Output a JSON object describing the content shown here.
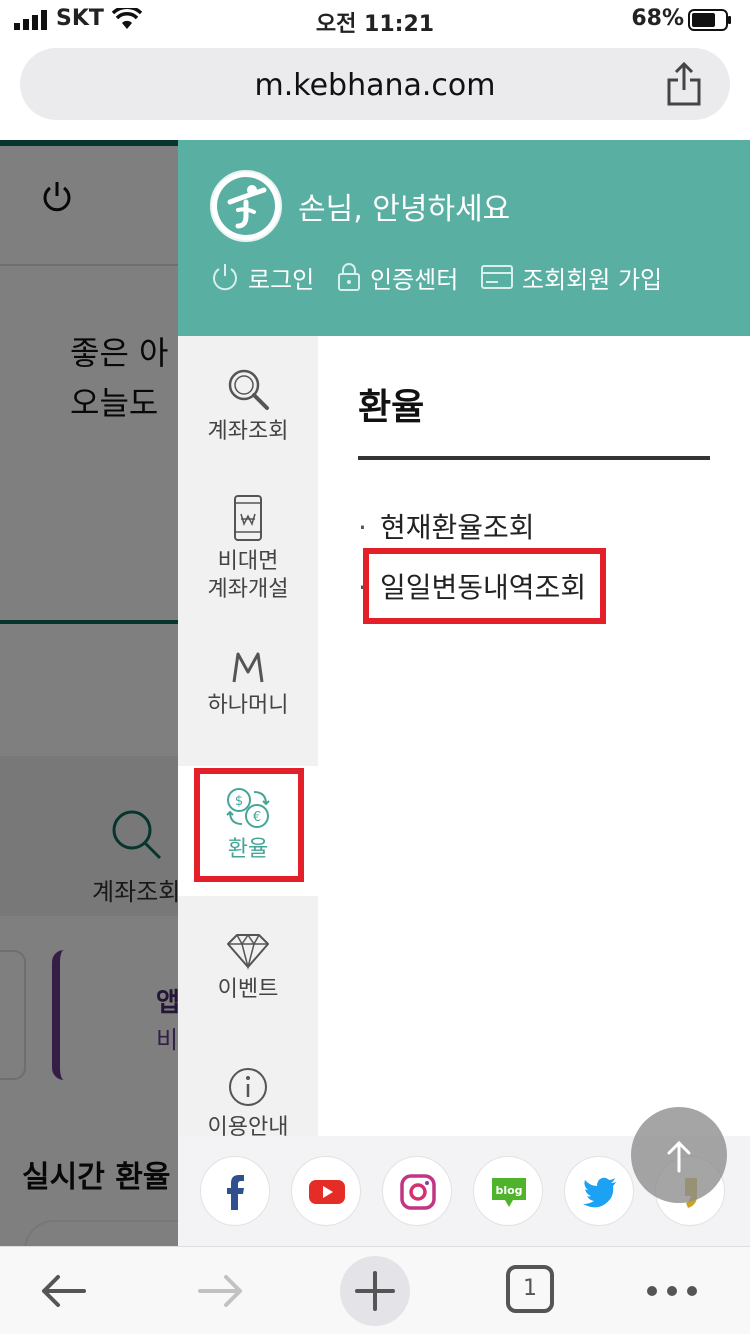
{
  "status_bar": {
    "carrier": "SKT",
    "time": "오전 11:21",
    "battery": "68%"
  },
  "browser": {
    "url": "m.kebhana.com",
    "tab_count": "1"
  },
  "background_page": {
    "greeting_line1": "좋은 아",
    "greeting_line2": "오늘도 ",
    "account_label": "계좌조회",
    "app_card_title": "앱",
    "app_card_sub": "비",
    "realtime_title": "실시간 환율"
  },
  "menu": {
    "greeting": "손님, 안녕하세요",
    "header_links": {
      "login": "로그인",
      "cert_center": "인증센터",
      "member_join": "조회회원 가입"
    },
    "tabs": [
      {
        "label": "계좌조회",
        "icon": "magnifier-icon"
      },
      {
        "label1": "비대면",
        "label2": "계좌개설",
        "icon": "mobile-won-icon"
      },
      {
        "label": "하나머니",
        "icon": "hana-money-m-icon"
      },
      {
        "label": "환율",
        "icon": "currency-exchange-icon",
        "active": true
      },
      {
        "label": "이벤트",
        "icon": "diamond-icon"
      },
      {
        "label": "이용안내",
        "icon": "info-icon"
      }
    ],
    "panel": {
      "title": "환율",
      "items": [
        "현재환율조회",
        "일일변동내역조회"
      ]
    },
    "social": [
      "facebook",
      "youtube",
      "instagram",
      "blog",
      "twitter",
      "kakao-story"
    ]
  },
  "colors": {
    "brand_teal": "#5aafa3",
    "active_teal": "#46a597",
    "highlight_red": "#e31f2a"
  }
}
